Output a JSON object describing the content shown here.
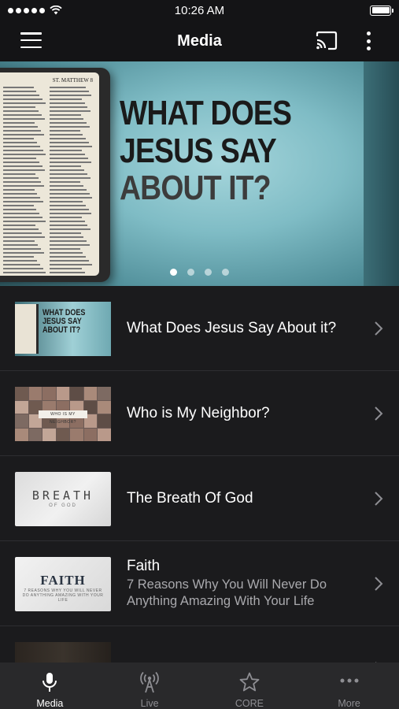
{
  "status_bar": {
    "time": "10:26 AM",
    "signal_dots": 5,
    "battery_level": 1.0
  },
  "nav": {
    "title": "Media"
  },
  "banner": {
    "title_lines": [
      "WHAT DOES",
      "JESUS SAY",
      "ABOUT IT?"
    ],
    "bible_header": "ST. MATTHEW 8",
    "page_count": 4,
    "active_page": 1
  },
  "media_items": [
    {
      "title": "What Does Jesus Say About it?",
      "subtitle": "",
      "thumb_text": [
        "WHAT DOES",
        "JESUS SAY",
        "ABOUT IT?"
      ]
    },
    {
      "title": "Who is My Neighbor?",
      "subtitle": "",
      "thumb_text": [
        "WHO IS MY NEIGHBOR?"
      ]
    },
    {
      "title": "The Breath Of God",
      "subtitle": "",
      "thumb_text": [
        "BREATH",
        "OF GOD"
      ]
    },
    {
      "title": "Faith",
      "subtitle": "7 Reasons Why You Will Never Do Anything Amazing With Your Life",
      "thumb_text": [
        "FAITH",
        "7 REASONS WHY YOU WILL NEVER DO ANYTHING AMAZING WITH YOUR LIFE"
      ]
    }
  ],
  "tabs": [
    {
      "label": "Media",
      "icon": "microphone-icon",
      "active": true
    },
    {
      "label": "Live",
      "icon": "broadcast-icon",
      "active": false
    },
    {
      "label": "CORE",
      "icon": "star-icon",
      "active": false
    },
    {
      "label": "More",
      "icon": "more-horizontal-icon",
      "active": false
    }
  ],
  "colors": {
    "background": "#1b1b1d",
    "nav_bar": "#141416",
    "tab_bar": "#29292b",
    "inactive_tab": "#8e8e93"
  }
}
